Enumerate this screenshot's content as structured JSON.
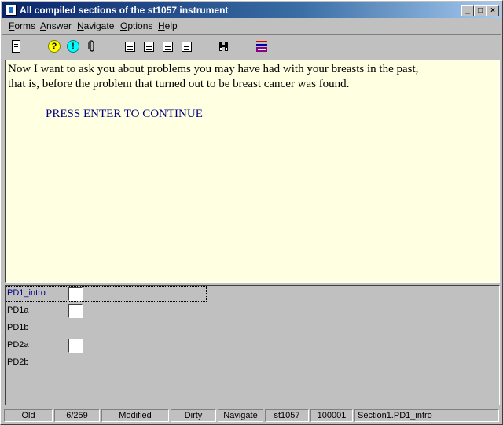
{
  "window": {
    "title": "All compiled sections of the st1057 instrument"
  },
  "menu": [
    {
      "label": "Forms",
      "accel": "F"
    },
    {
      "label": "Answer",
      "accel": "A"
    },
    {
      "label": "Navigate",
      "accel": "N"
    },
    {
      "label": "Options",
      "accel": "O"
    },
    {
      "label": "Help",
      "accel": "H"
    }
  ],
  "toolbar": {
    "icons": [
      "page-icon",
      "question-help-icon",
      "exclamation-icon",
      "paperclip-icon",
      "frame-first-icon",
      "frame-prev-icon",
      "frame-next-icon",
      "frame-last-icon",
      "binoculars-icon",
      "flag-icon"
    ],
    "qmark": "?",
    "emark": "!"
  },
  "question": {
    "line1": "Now I want to ask you about problems you may have had with your breasts in the past,",
    "line2": "that is, before the problem that turned out to be breast cancer was found.",
    "press": "PRESS ENTER TO CONTINUE"
  },
  "fields": [
    {
      "name": "PD1_intro",
      "has_box": true,
      "active": true
    },
    {
      "name": "PD1a",
      "has_box": true,
      "active": false
    },
    {
      "name": "PD1b",
      "has_box": false,
      "active": false
    },
    {
      "name": "PD2a",
      "has_box": true,
      "active": false
    },
    {
      "name": "PD2b",
      "has_box": false,
      "active": false
    }
  ],
  "status": [
    "Old",
    "6/259",
    "Modified",
    "Dirty",
    "Navigate",
    "st1057",
    "100001",
    "Section1.PD1_intro"
  ],
  "colors": {
    "question_bg": "#ffffe1",
    "press_text": "#000080",
    "titlebar_start": "#0a246a",
    "titlebar_end": "#a6caf0"
  }
}
